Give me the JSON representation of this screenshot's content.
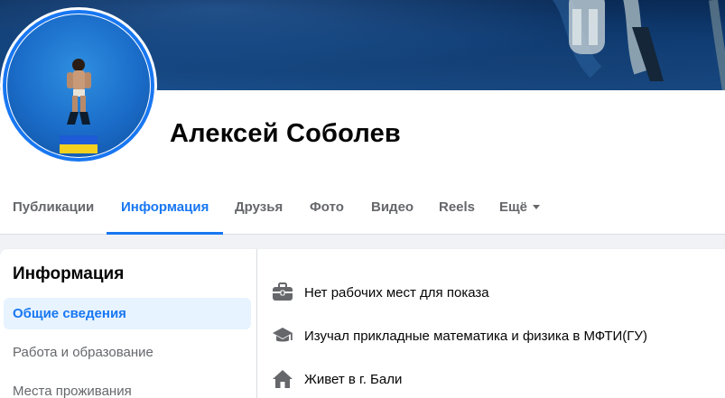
{
  "profile": {
    "name": "Алексей Соболев"
  },
  "tabs": [
    {
      "label": "Публикации",
      "active": false
    },
    {
      "label": "Информация",
      "active": true
    },
    {
      "label": "Друзья",
      "active": false
    },
    {
      "label": "Фото",
      "active": false
    },
    {
      "label": "Видео",
      "active": false
    },
    {
      "label": "Reels",
      "active": false
    },
    {
      "label": "Ещё",
      "active": false,
      "icon": "caret-down-icon"
    }
  ],
  "sidebar": {
    "title": "Информация",
    "items": [
      {
        "label": "Общие сведения",
        "active": true
      },
      {
        "label": "Работа и образование",
        "active": false
      },
      {
        "label": "Места проживания",
        "active": false
      }
    ]
  },
  "overview": [
    {
      "icon": "briefcase-icon",
      "text": "Нет рабочих мест для показа"
    },
    {
      "icon": "graduation-cap-icon",
      "text": "Изучал прикладные математика и физика в МФТИ(ГУ)"
    },
    {
      "icon": "home-icon",
      "text": "Живет в г. Бали"
    }
  ],
  "colors": {
    "accent": "#1877f2",
    "muted_text": "#65676b",
    "active_bg": "#e7f3ff",
    "page_bg": "#f0f2f5"
  }
}
